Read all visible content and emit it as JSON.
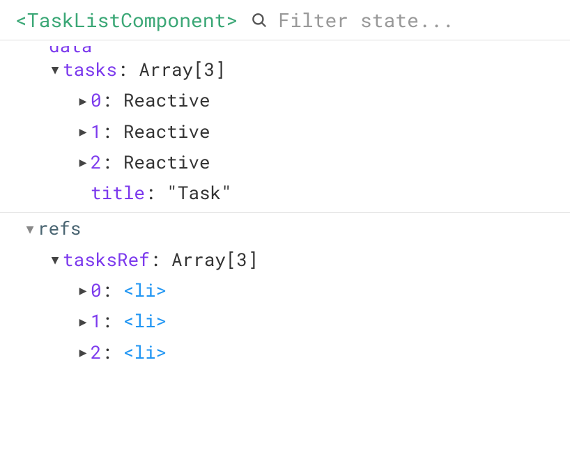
{
  "header": {
    "component_tag": "<TaskListComponent>",
    "search_placeholder": "Filter state..."
  },
  "tree": {
    "truncated_key": "data",
    "data": {
      "tasks_key": "tasks",
      "tasks_value": "Array[3]",
      "tasks_items": [
        {
          "index": "0",
          "value": "Reactive"
        },
        {
          "index": "1",
          "value": "Reactive"
        },
        {
          "index": "2",
          "value": "Reactive"
        }
      ],
      "title_key": "title",
      "title_value": "\"Task\""
    },
    "refs_section": "refs",
    "refs": {
      "tasksRef_key": "tasksRef",
      "tasksRef_value": "Array[3]",
      "tasksRef_items": [
        {
          "index": "0",
          "tag": "<li>"
        },
        {
          "index": "1",
          "tag": "<li>"
        },
        {
          "index": "2",
          "tag": "<li>"
        }
      ]
    }
  },
  "glyphs": {
    "arrow_down": "▼",
    "arrow_right": "▶",
    "arrow_down_small": "▼"
  }
}
